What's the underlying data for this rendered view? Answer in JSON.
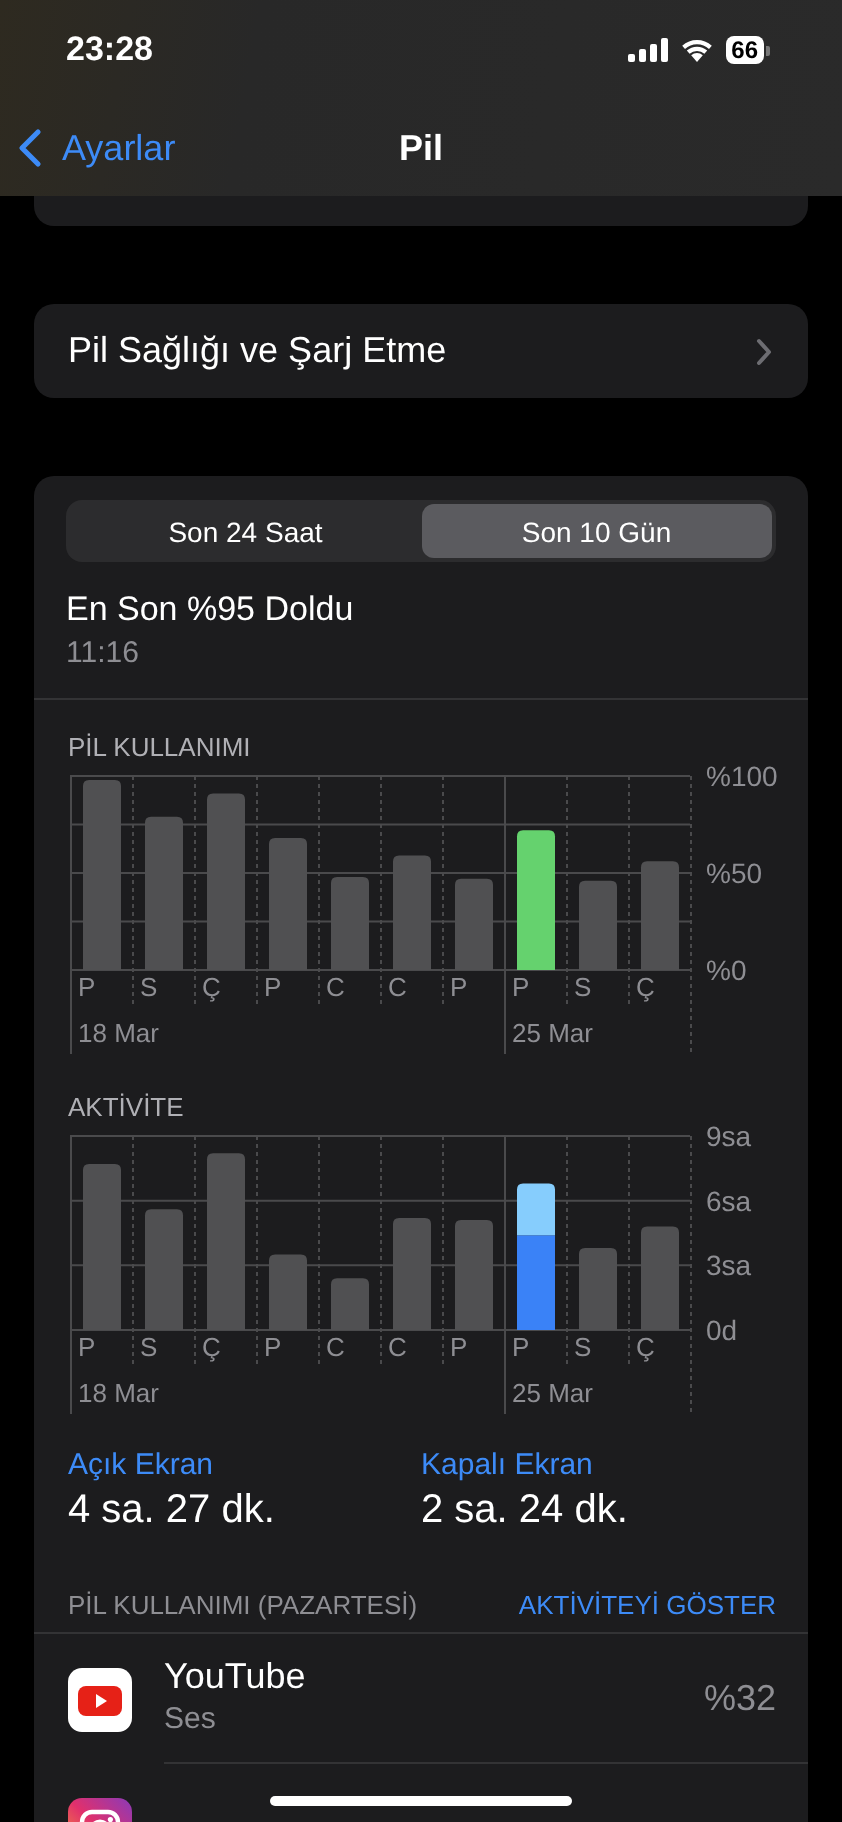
{
  "status_bar": {
    "time": "23:28",
    "battery_text": "66"
  },
  "nav": {
    "back": "Ayarlar",
    "title": "Pil"
  },
  "health_row": {
    "label": "Pil Sağlığı ve Şarj Etme"
  },
  "usage_card": {
    "segments": [
      {
        "label": "Son 24 Saat",
        "selected": false
      },
      {
        "label": "Son 10 Gün",
        "selected": true
      }
    ],
    "last_charge": {
      "title": "En Son %95 Doldu",
      "time": "11:16"
    },
    "charts": [
      {
        "chart_data": {
          "type": "bar",
          "title": "PİL KULLANIMI",
          "categories": [
            "P",
            "S",
            "Ç",
            "P",
            "C",
            "C",
            "P",
            "P",
            "S",
            "Ç"
          ],
          "stacked": true,
          "series": [
            {
              "color": "#505052",
              "values": [
                98,
                79,
                91,
                68,
                48,
                59,
                47,
                null,
                46,
                56
              ]
            },
            {
              "color": "#65d26e",
              "values": [
                null,
                null,
                null,
                null,
                null,
                null,
                null,
                72,
                null,
                null
              ]
            }
          ],
          "ylim": [
            0,
            100
          ],
          "yticks": [
            {
              "value": 0,
              "label": "%0"
            },
            {
              "value": 50,
              "label": "%50"
            },
            {
              "value": 100,
              "label": "%100"
            }
          ]
        },
        "week_labels": [
          "18 Mar",
          "25 Mar"
        ]
      },
      {
        "chart_data": {
          "type": "bar",
          "title": "AKTİVİTE",
          "categories": [
            "P",
            "S",
            "Ç",
            "P",
            "C",
            "C",
            "P",
            "P",
            "S",
            "Ç"
          ],
          "stacked": true,
          "series": [
            {
              "color": "#505052",
              "values": [
                7.7,
                5.6,
                8.2,
                3.5,
                2.4,
                5.2,
                5.1,
                null,
                3.8,
                4.8
              ]
            },
            {
              "color": "#3a82f7",
              "values": [
                null,
                null,
                null,
                null,
                null,
                null,
                null,
                4.4,
                null,
                null
              ]
            },
            {
              "color": "#86cdfd",
              "values": [
                null,
                null,
                null,
                null,
                null,
                null,
                null,
                2.4,
                null,
                null
              ]
            }
          ],
          "ylim": [
            0,
            9
          ],
          "yticks": [
            {
              "value": 0,
              "label": "0d"
            },
            {
              "value": 3,
              "label": "3sa"
            },
            {
              "value": 6,
              "label": "6sa"
            },
            {
              "value": 9,
              "label": "9sa"
            }
          ]
        },
        "week_labels": [
          "18 Mar",
          "25 Mar"
        ]
      }
    ],
    "totals": [
      {
        "label": "Açık Ekran",
        "value": "4 sa. 27 dk."
      },
      {
        "label": "Kapalı Ekran",
        "value": "2 sa. 24 dk."
      }
    ],
    "list_header": {
      "title": "PİL KULLANIMI (PAZARTESİ)",
      "action": "AKTİVİTEYİ GÖSTER"
    },
    "apps": [
      {
        "kind": "video",
        "name": "YouTube",
        "detail": "Ses",
        "share": "%32"
      },
      {
        "kind": "camera"
      }
    ]
  }
}
